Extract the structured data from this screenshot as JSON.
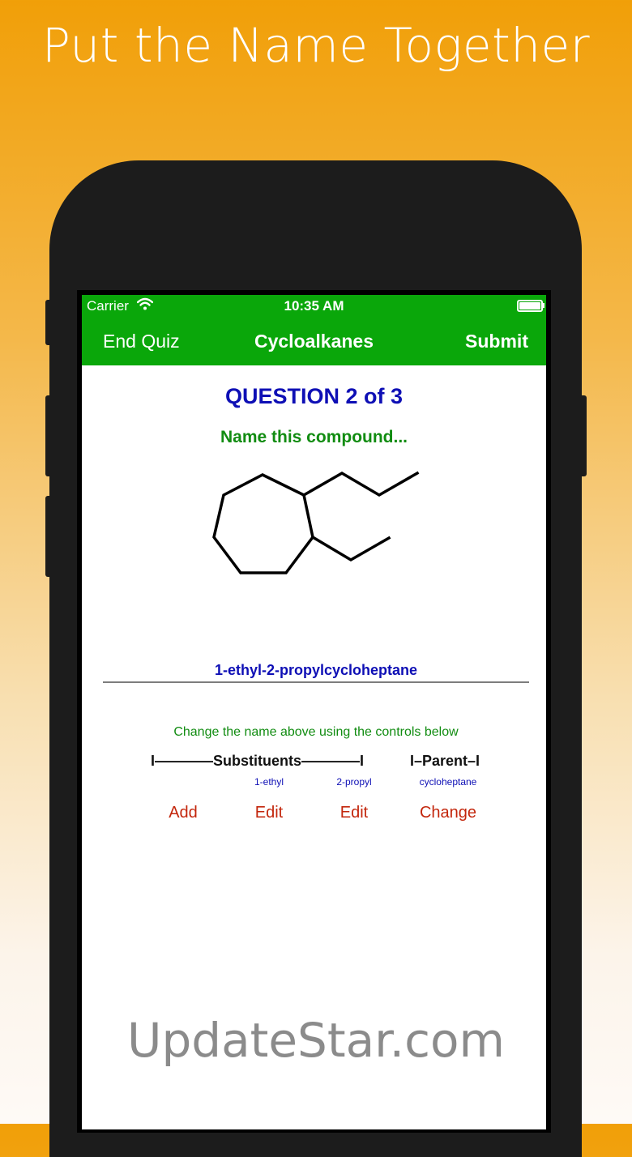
{
  "promo": {
    "headline": "Put the Name Together"
  },
  "status_bar": {
    "carrier": "Carrier",
    "time": "10:35 AM"
  },
  "nav": {
    "left_label": "End Quiz",
    "title": "Cycloalkanes",
    "right_label": "Submit"
  },
  "question": {
    "title": "QUESTION 2 of 3",
    "prompt": "Name this compound...",
    "answer_name": "1-ethyl-2-propylcycloheptane"
  },
  "controls": {
    "instructions": "Change the name above using the controls below",
    "substituents_header": "I————Substituents————I",
    "parent_header": "I–Parent–I",
    "tokens": [
      "1-ethyl",
      "2-propyl",
      "cycloheptane"
    ],
    "buttons": [
      "Add",
      "Edit",
      "Edit",
      "Change"
    ]
  },
  "watermark": "UpdateStar.com",
  "colors": {
    "nav_green": "#0aa70a",
    "question_blue": "#0e0fb5",
    "prompt_green": "#118c11",
    "control_red": "#c3260c",
    "background_orange": "#f19f08"
  }
}
